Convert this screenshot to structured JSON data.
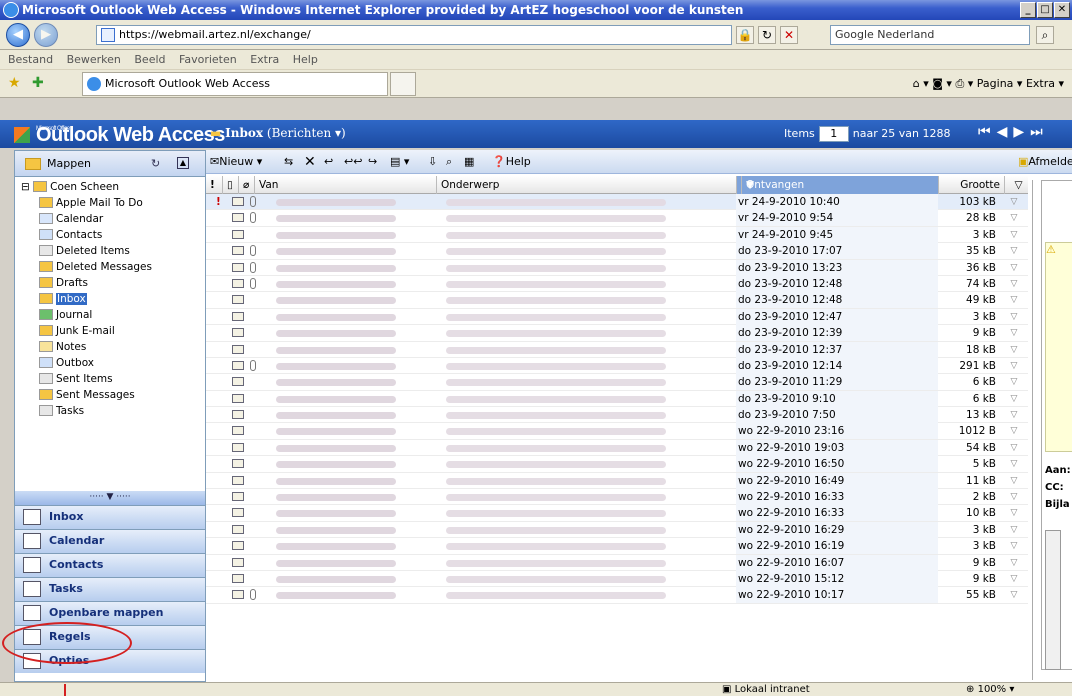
{
  "window": {
    "title": "Microsoft Outlook Web Access - Windows Internet Explorer provided by ArtEZ hogeschool voor de kunsten"
  },
  "address": {
    "url": "https://webmail.artez.nl/exchange/",
    "search_placeholder": "Google Nederland"
  },
  "menu": [
    "Bestand",
    "Bewerken",
    "Beeld",
    "Favorieten",
    "Extra",
    "Help"
  ],
  "tab": {
    "label": "Microsoft Outlook Web Access"
  },
  "ietools": {
    "label": "Pagina ▾  Extra ▾"
  },
  "owa": {
    "logo_small": "Microsoft Office",
    "logo": "Outlook Web Access",
    "folder": "Inbox",
    "folder_sub": "(Berichten ▾)",
    "items_label": "Items",
    "page": "1",
    "range": "naar 25 van 1288"
  },
  "sidebar": {
    "header": "Mappen",
    "root": "Coen Scheen",
    "folders": [
      "Apple Mail To Do",
      "Calendar",
      "Contacts",
      "Deleted Items",
      "Deleted Messages",
      "Drafts",
      "Inbox",
      "Journal",
      "Junk E-mail",
      "Notes",
      "Outbox",
      "Sent Items",
      "Sent Messages",
      "Tasks"
    ],
    "selected": "Inbox",
    "nav": [
      "Inbox",
      "Calendar",
      "Contacts",
      "Tasks",
      "Openbare mappen",
      "Regels",
      "Opties"
    ]
  },
  "toolbar": {
    "new": "Nieuw",
    "help": "Help",
    "logout": "Afmelden"
  },
  "columns": {
    "from": "Van",
    "subject": "Onderwerp",
    "received": "Ontvangen",
    "size": "Grootte"
  },
  "messages": [
    {
      "date": "vr 24-9-2010 10:40",
      "size": "103 kB"
    },
    {
      "date": "vr 24-9-2010 9:54",
      "size": "28 kB"
    },
    {
      "date": "vr 24-9-2010 9:45",
      "size": "3 kB"
    },
    {
      "date": "do 23-9-2010 17:07",
      "size": "35 kB"
    },
    {
      "date": "do 23-9-2010 13:23",
      "size": "36 kB"
    },
    {
      "date": "do 23-9-2010 12:48",
      "size": "74 kB"
    },
    {
      "date": "do 23-9-2010 12:48",
      "size": "49 kB"
    },
    {
      "date": "do 23-9-2010 12:47",
      "size": "3 kB"
    },
    {
      "date": "do 23-9-2010 12:39",
      "size": "9 kB"
    },
    {
      "date": "do 23-9-2010 12:37",
      "size": "18 kB"
    },
    {
      "date": "do 23-9-2010 12:14",
      "size": "291 kB"
    },
    {
      "date": "do 23-9-2010 11:29",
      "size": "6 kB"
    },
    {
      "date": "do 23-9-2010 9:10",
      "size": "6 kB"
    },
    {
      "date": "do 23-9-2010 7:50",
      "size": "13 kB"
    },
    {
      "date": "wo 22-9-2010 23:16",
      "size": "1012 B"
    },
    {
      "date": "wo 22-9-2010 19:03",
      "size": "54 kB"
    },
    {
      "date": "wo 22-9-2010 16:50",
      "size": "5 kB"
    },
    {
      "date": "wo 22-9-2010 16:49",
      "size": "11 kB"
    },
    {
      "date": "wo 22-9-2010 16:33",
      "size": "2 kB"
    },
    {
      "date": "wo 22-9-2010 16:33",
      "size": "10 kB"
    },
    {
      "date": "wo 22-9-2010 16:29",
      "size": "3 kB"
    },
    {
      "date": "wo 22-9-2010 16:19",
      "size": "3 kB"
    },
    {
      "date": "wo 22-9-2010 16:07",
      "size": "9 kB"
    },
    {
      "date": "wo 22-9-2010 15:12",
      "size": "9 kB"
    },
    {
      "date": "wo 22-9-2010 10:17",
      "size": "55 kB"
    }
  ],
  "readpane": {
    "aan": "Aan:",
    "cc": "CC:",
    "bijla": "Bijla"
  },
  "status": {
    "zone": "Lokaal intranet",
    "zoom": "100%"
  }
}
